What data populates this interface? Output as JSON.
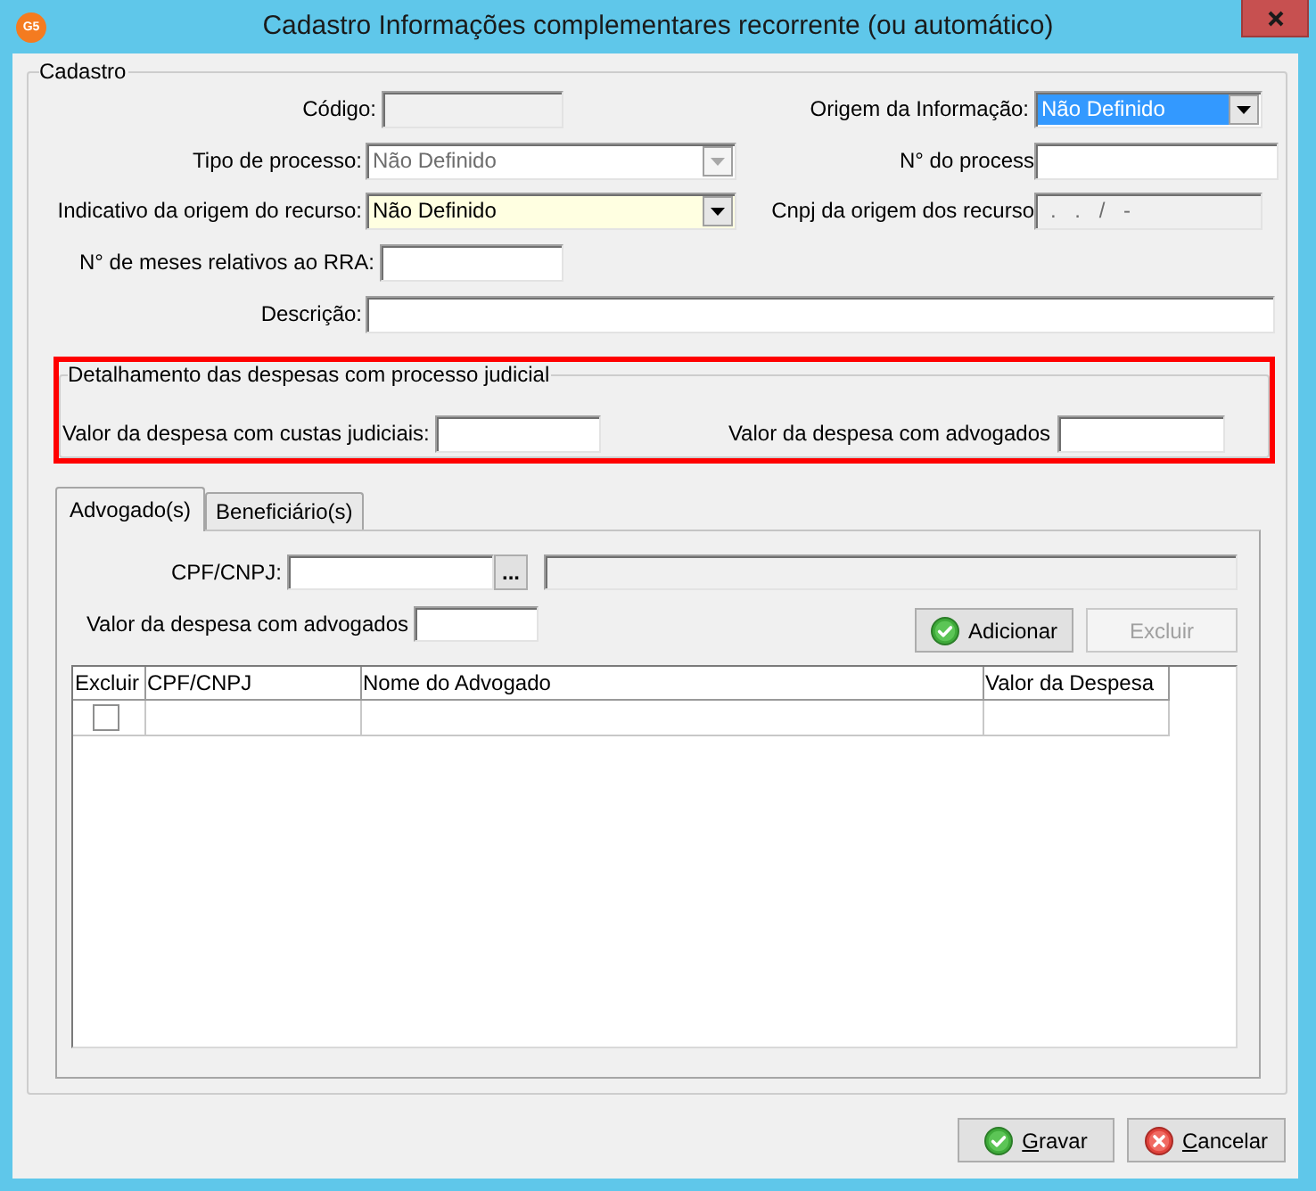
{
  "window": {
    "logo_text": "G5",
    "title": "Cadastro Informações complementares recorrente (ou automático)"
  },
  "cadastro": {
    "legend": "Cadastro",
    "codigo": {
      "label": "Código:",
      "disabled": true
    },
    "origem_informacao": {
      "label": "Origem da Informação:",
      "value": "Não Definido",
      "focused": true
    },
    "tipo_processo": {
      "label": "Tipo de processo:",
      "value": "Não Definido",
      "disabled": true
    },
    "numero_processo": {
      "label": "N° do process"
    },
    "indicativo_origem": {
      "label": "Indicativo da origem do recurso:",
      "value": "Não Definido",
      "highlighted": true
    },
    "cnpj_origem": {
      "label": "Cnpj da origem dos recurso",
      "value": ". . / -",
      "disabled": true
    },
    "meses_rra": {
      "label": "N° de meses relativos ao RRA:"
    },
    "descricao": {
      "label": "Descrição:"
    }
  },
  "expenses": {
    "legend": "Detalhamento das despesas com processo judicial",
    "highlighted": true,
    "custas": {
      "label": "Valor da despesa com custas judiciais:"
    },
    "advogados": {
      "label": "Valor da despesa com advogados"
    }
  },
  "tabs": [
    {
      "label": "Advogado(s)",
      "selected": true
    },
    {
      "label": "Beneficiário(s)",
      "selected": false
    }
  ],
  "advogado_panel": {
    "cpf": {
      "label": "CPF/CNPJ:",
      "button": "..."
    },
    "readonly_field": {
      "disabled": true
    },
    "valor": {
      "label": "Valor da despesa com advogados"
    },
    "buttons": [
      {
        "label": "Adicionar",
        "kind": "add",
        "disabled": false
      },
      {
        "label": "Excluir",
        "kind": "delete",
        "disabled": true
      }
    ]
  },
  "table": {
    "columns": [
      "Excluir",
      "CPF/CNPJ",
      "Nome do Advogado",
      "Valor da Despesa"
    ],
    "rows": [
      {
        "checked": false
      }
    ]
  },
  "footer_buttons": [
    {
      "label": "Gravar",
      "kind": "save",
      "access_key_underlined": true
    },
    {
      "label": "Cancelar",
      "kind": "cancel",
      "access_key_underlined": true
    }
  ]
}
